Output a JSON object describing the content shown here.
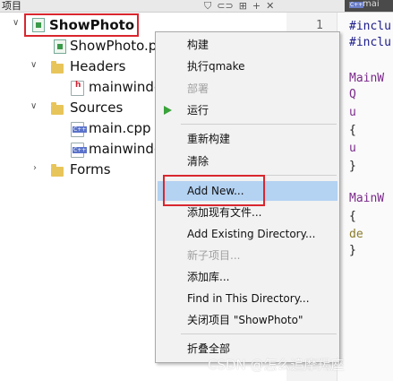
{
  "panel": {
    "title": "项目"
  },
  "editor_tab": {
    "badge": "C++",
    "label": "mai"
  },
  "tree": {
    "project": "ShowPhoto",
    "pro_file": "ShowPhoto.p",
    "headers_label": "Headers",
    "header_file": "mainwindo",
    "sources_label": "Sources",
    "source_main": "main.cpp",
    "source_mainwindow": "mainwindo",
    "forms_label": "Forms",
    "file_badge": "C++"
  },
  "editor": {
    "line_number": "1",
    "lines": [
      "#inclu",
      "#inclu",
      "",
      "MainW",
      "    Q",
      "    u",
      "{",
      "    u",
      "}",
      "",
      "MainW",
      "{",
      "    de",
      "}"
    ]
  },
  "context_menu": {
    "items": [
      {
        "label": "构建",
        "enabled": true
      },
      {
        "label": "执行qmake",
        "enabled": true
      },
      {
        "label": "部署",
        "enabled": false
      },
      {
        "label": "运行",
        "enabled": true
      },
      {
        "label": "重新构建",
        "enabled": true
      },
      {
        "label": "清除",
        "enabled": true
      },
      {
        "label": "Add New...",
        "enabled": true
      },
      {
        "label": "添加现有文件...",
        "enabled": true
      },
      {
        "label": "Add Existing Directory...",
        "enabled": true
      },
      {
        "label": "新子项目...",
        "enabled": false
      },
      {
        "label": "添加库...",
        "enabled": true
      },
      {
        "label": "Find in This Directory...",
        "enabled": true
      },
      {
        "label": "关闭项目 \"ShowPhoto\"",
        "enabled": true
      },
      {
        "label": "折叠全部",
        "enabled": true
      }
    ]
  },
  "watermark": "CSDN @怎么追摩羯座",
  "colors": {
    "highlight": "#d9262e",
    "hover": "#b4d2f2",
    "folder": "#e8c55a",
    "run": "#3aa23a"
  }
}
